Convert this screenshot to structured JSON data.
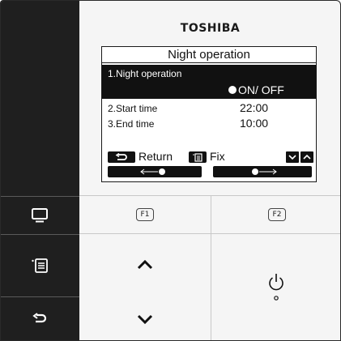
{
  "brand": "TOSHIBA",
  "screen": {
    "title": "Night operation",
    "items": [
      {
        "label": "1.Night operation",
        "value": "ON/ OFF",
        "selected": true
      },
      {
        "label": "2.Start time",
        "value": "22:00"
      },
      {
        "label": "3.End time",
        "value": "10:00"
      }
    ],
    "footer": {
      "return_label": "Return",
      "fix_label": "Fix"
    }
  },
  "keys": {
    "f1_label": "F1",
    "f2_label": "F2"
  },
  "icons": {
    "monitor": "monitor-icon",
    "menu": "menu-icon",
    "return": "return-icon",
    "up": "chevron-up-icon",
    "down": "chevron-down-icon",
    "power": "power-icon"
  },
  "colors": {
    "sidebar": "#1f1f1f",
    "lcd_highlight": "#111111",
    "panel": "#f5f5f5"
  }
}
